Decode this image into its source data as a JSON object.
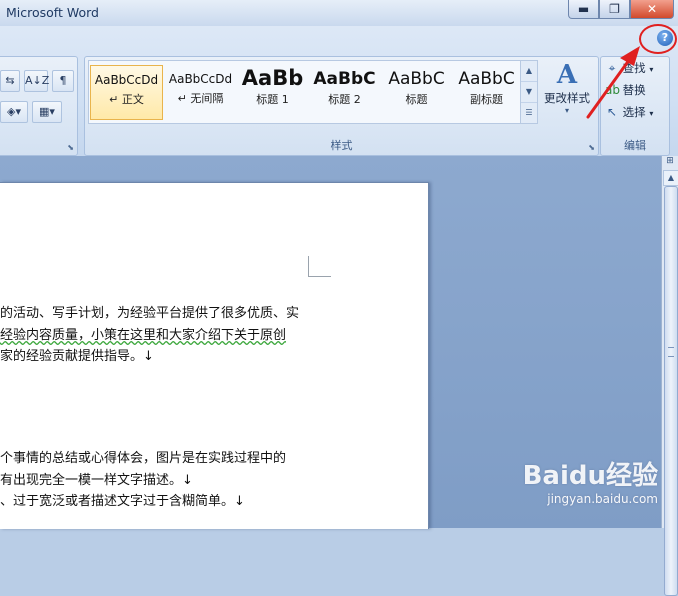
{
  "window": {
    "title": "Microsoft Word",
    "minimize": "▬",
    "restore": "❐",
    "close": "✕"
  },
  "ribbon": {
    "help_icon": "?",
    "left_tools": [
      "A↓Z",
      "¶"
    ],
    "styles_group": {
      "label": "样式",
      "items": [
        {
          "preview": "AaBbCcDd",
          "name": "↵ 正文",
          "selected": true
        },
        {
          "preview": "AaBbCcDd",
          "name": "↵ 无间隔",
          "selected": false
        },
        {
          "preview": "AaBb",
          "name": "标题 1",
          "selected": false
        },
        {
          "preview": "AaBbC",
          "name": "标题 2",
          "selected": false
        },
        {
          "preview": "AaBbC",
          "name": "标题",
          "selected": false
        },
        {
          "preview": "AaBbC",
          "name": "副标题",
          "selected": false
        }
      ],
      "change_styles_label": "更改样式"
    },
    "editing_group": {
      "label": "编辑",
      "find": "查找",
      "replace": "替换",
      "select": "选择"
    }
  },
  "document": {
    "lines": [
      "的活动、写手计划，为经验平台提供了很多优质、实",
      "经验内容质量，小策在这里和大家介绍下关于原创",
      "家的经验贡献提供指导。↓",
      "个事情的总结或心得体会，图片是在实践过程中的",
      "有出现完全一模一样文字描述。↓",
      "、过于宽泛或者描述文字过于含糊简单。↓"
    ]
  },
  "watermark": {
    "logo": "Baidu经验",
    "url": "jingyan.baidu.com"
  }
}
